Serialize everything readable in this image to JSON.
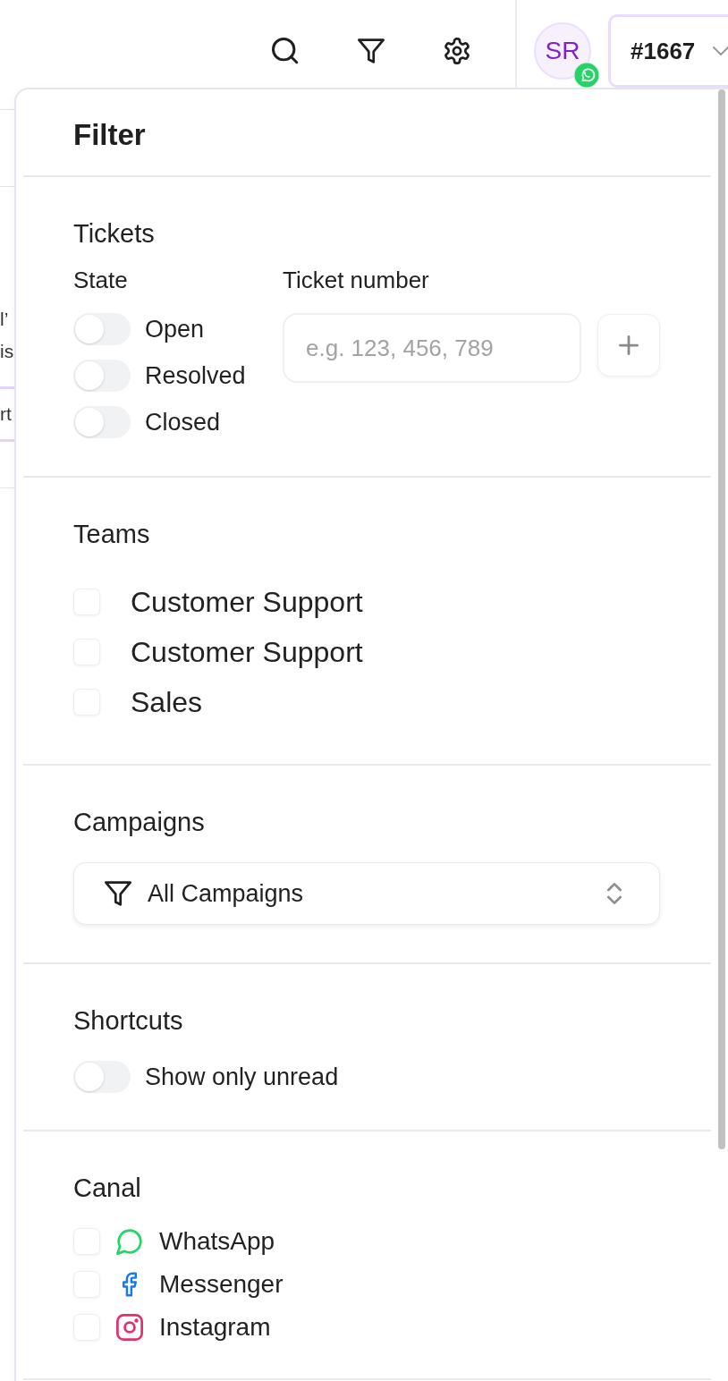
{
  "background": {
    "fragments": [
      "l’",
      "is",
      "rt"
    ]
  },
  "header": {
    "avatar": {
      "initials": "SR"
    },
    "ticket_selector": {
      "label": "#1667"
    }
  },
  "filter": {
    "title": "Filter",
    "tickets": {
      "heading": "Tickets",
      "state": {
        "label": "State",
        "options": [
          {
            "label": "Open",
            "on": false
          },
          {
            "label": "Resolved",
            "on": false
          },
          {
            "label": "Closed",
            "on": false
          }
        ]
      },
      "ticket_number": {
        "label": "Ticket number",
        "placeholder": "e.g. 123, 456, 789"
      }
    },
    "teams": {
      "heading": "Teams",
      "items": [
        {
          "label": "Customer Support",
          "checked": false
        },
        {
          "label": "Customer Support",
          "checked": false
        },
        {
          "label": "Sales",
          "checked": false
        }
      ]
    },
    "campaigns": {
      "heading": "Campaigns",
      "select": {
        "value": "All Campaigns"
      }
    },
    "shortcuts": {
      "heading": "Shortcuts",
      "toggles": [
        {
          "label": "Show only unread",
          "on": false
        }
      ]
    },
    "canal": {
      "heading": "Canal",
      "items": [
        {
          "label": "WhatsApp",
          "kind": "whatsapp",
          "checked": false
        },
        {
          "label": "Messenger",
          "kind": "messenger",
          "checked": false
        },
        {
          "label": "Instagram",
          "kind": "instagram",
          "checked": false
        }
      ]
    }
  }
}
